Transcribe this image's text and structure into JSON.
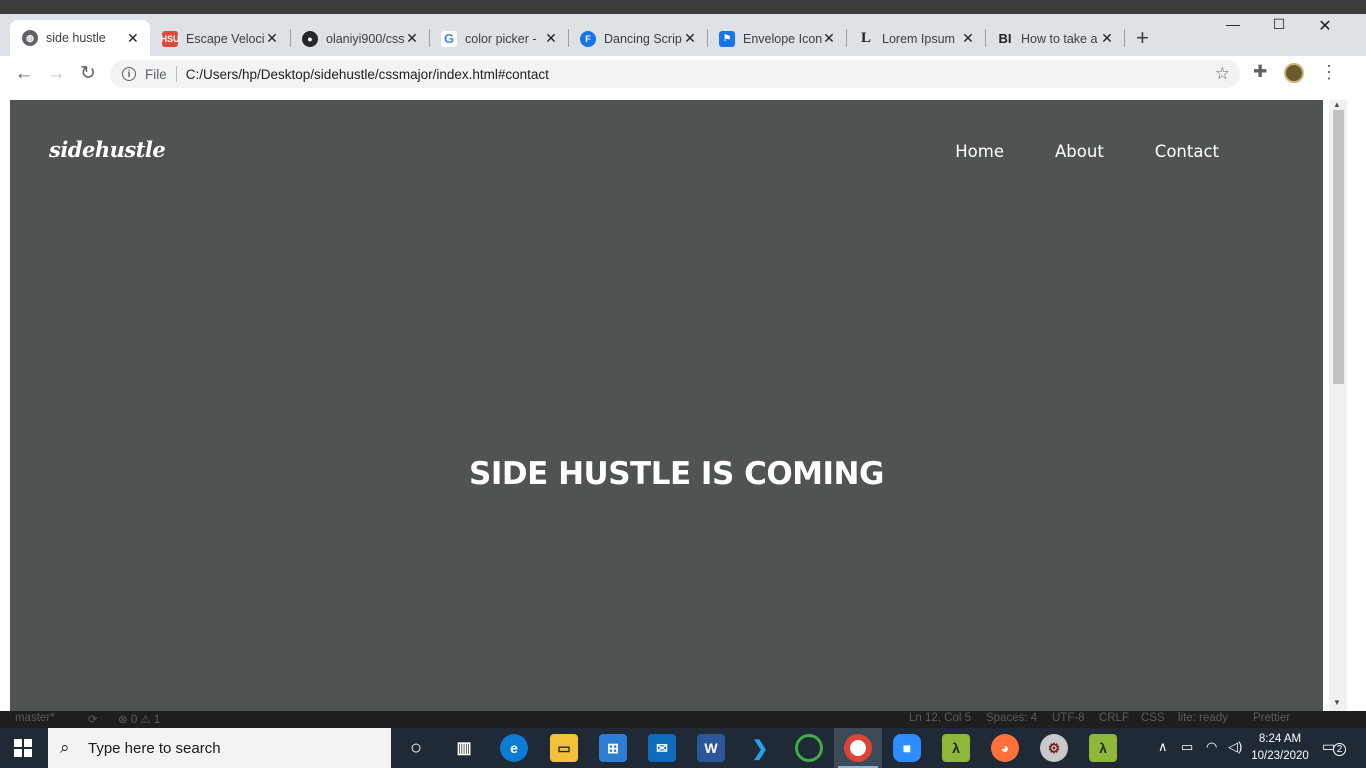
{
  "browser": {
    "tabs": [
      {
        "title": "side hustle",
        "favicon": "globe-icon",
        "color": "#5f6368",
        "active": true
      },
      {
        "title": "Escape Velocit",
        "favicon": "hsu-icon",
        "color": "#e0493b"
      },
      {
        "title": "olaniyi900/css",
        "favicon": "github-icon",
        "color": "#24292e"
      },
      {
        "title": "color picker -",
        "favicon": "google-icon",
        "color": "#4285f4"
      },
      {
        "title": "Dancing Scrip",
        "favicon": "fonts-icon",
        "color": "#1a73e8"
      },
      {
        "title": "Envelope Icon",
        "favicon": "flag-icon",
        "color": "#1a73e8"
      },
      {
        "title": "Lorem Ipsum",
        "favicon": "lorem-icon",
        "color": "#202124"
      },
      {
        "title": "How to take a",
        "favicon": "bi-icon",
        "color": "#202124"
      }
    ],
    "fav_text": {
      "hsu": "HSU",
      "google": "G",
      "fonts": "F",
      "lorem": "L",
      "bi": "BI"
    },
    "address": {
      "scheme": "File",
      "url": "C:/Users/hp/Desktop/sidehustle/cssmajor/index.html#contact"
    }
  },
  "page": {
    "brand": "sidehustle",
    "nav": [
      "Home",
      "About",
      "Contact"
    ],
    "hero": "SIDE HUSTLE IS COMING",
    "background": "#4f5450"
  },
  "vscode_status": {
    "branch": "master*",
    "errors": "⊗ 0 ⚠ 1",
    "position": "Ln 12, Col 5",
    "spaces": "Spaces: 4",
    "encoding": "UTF-8",
    "eol": "CRLF",
    "language": "CSS",
    "lint": "lite: ready",
    "formatter": "Prettier"
  },
  "taskbar": {
    "search_placeholder": "Type here to search",
    "time": "8:24 AM",
    "date": "10/23/2020",
    "notifications": "2"
  }
}
